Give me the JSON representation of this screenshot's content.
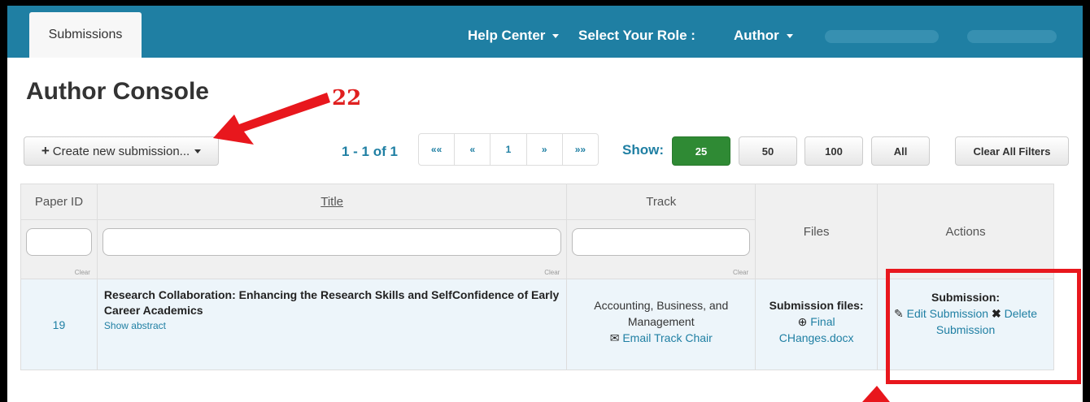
{
  "nav": {
    "tab": "Submissions",
    "help_center": "Help Center",
    "select_role_label": "Select Your Role :",
    "role": "Author"
  },
  "page": {
    "title": "Author Console",
    "annotation_number": "22"
  },
  "toolbar": {
    "create_label": "Create new submission...",
    "range_text": "1 - 1 of 1",
    "pager": [
      "««",
      "«",
      "1",
      "»",
      "»»"
    ],
    "show_label": "Show:",
    "show_options": [
      "25",
      "50",
      "100",
      "All"
    ],
    "clear_filters": "Clear All Filters"
  },
  "table": {
    "headers": {
      "paper_id": "Paper ID",
      "title": "Title",
      "track": "Track",
      "files": "Files",
      "actions": "Actions"
    },
    "clear_label": "Clear",
    "row": {
      "paper_id": "19",
      "title": "Research Collaboration: Enhancing the Research Skills and SelfConfidence of Early Career Academics",
      "show_abstract": "Show abstract",
      "track": "Accounting, Business, and Management",
      "email_track_chair": "Email Track Chair",
      "files_label": "Submission files:",
      "file_name": "Final CHanges.docx",
      "actions_label": "Submission:",
      "edit": "Edit Submission",
      "delete": "Delete Submission"
    }
  },
  "colors": {
    "navbar": "#1f7fa3",
    "annotation": "#e8171d",
    "active_show": "#2f8a34"
  }
}
